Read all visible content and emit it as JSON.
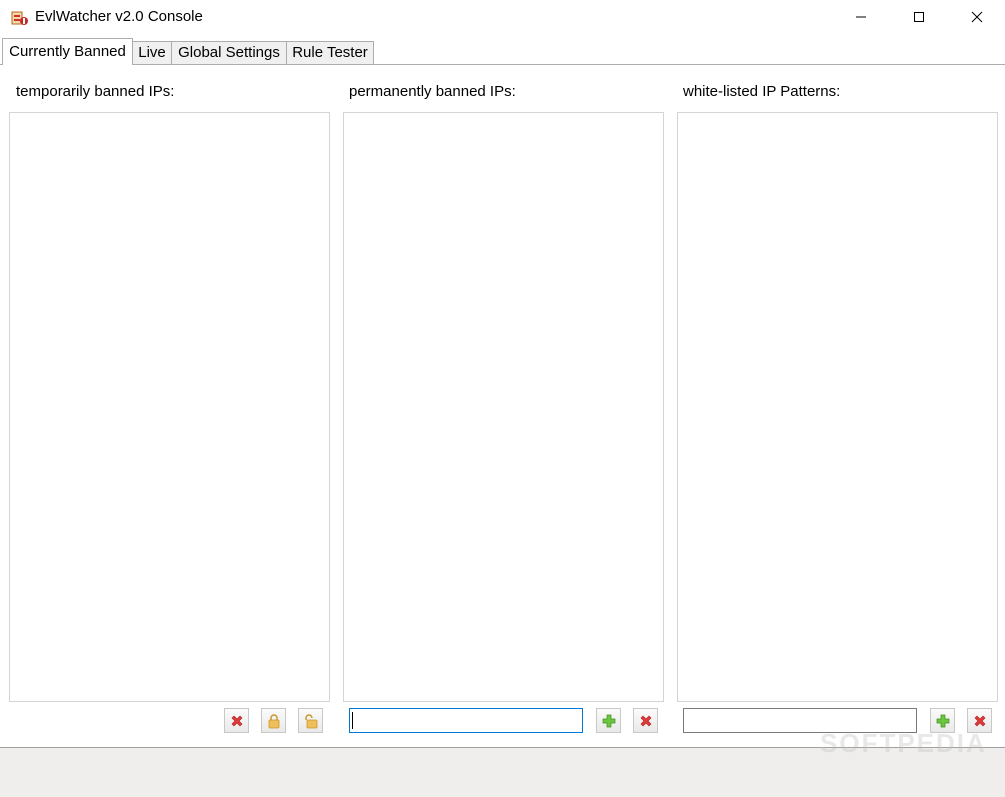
{
  "window": {
    "title": "EvlWatcher v2.0 Console"
  },
  "tabs": [
    {
      "label": "Currently Banned",
      "active": true
    },
    {
      "label": "Live",
      "active": false
    },
    {
      "label": "Global Settings",
      "active": false
    },
    {
      "label": "Rule Tester",
      "active": false
    }
  ],
  "panels": {
    "temporary": {
      "label": "temporarily banned IPs:",
      "items": []
    },
    "permanent": {
      "label": "permanently banned IPs:",
      "items": [],
      "input_value": ""
    },
    "whitelist": {
      "label": "white-listed IP Patterns:",
      "items": [],
      "input_value": ""
    }
  },
  "icons": {
    "remove": "red-x-icon",
    "lock": "lock-icon",
    "unlock": "unlock-icon",
    "add": "green-plus-icon"
  },
  "colors": {
    "remove_red": "#e03a3a",
    "add_green": "#5cb531",
    "lock_gold": "#e8b84a",
    "focus_blue": "#0078d7"
  },
  "watermark": "SOFTPEDIA"
}
